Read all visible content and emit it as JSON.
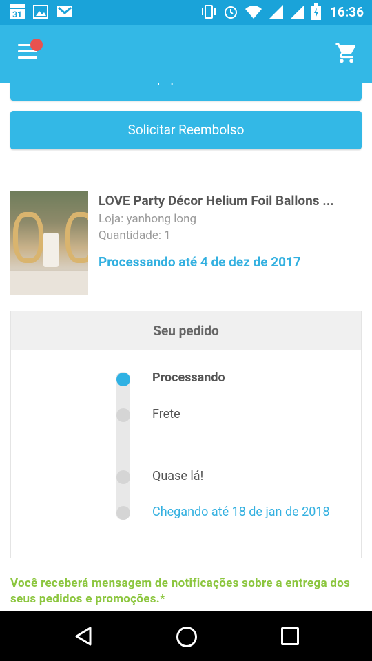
{
  "status_bar": {
    "calendar_day": "31",
    "time": "16:36",
    "icons": [
      "calendar-icon",
      "image-icon",
      "gmail-icon",
      "vibrate-icon",
      "alarm-icon",
      "wifi-icon",
      "signal-icon",
      "signal-icon",
      "battery-icon"
    ]
  },
  "app_bar": {
    "menu_icon": "hamburger-menu-icon",
    "cart_icon": "shopping-cart-icon",
    "notification_dot_color": "#e8524f"
  },
  "buttons": {
    "contact": "Contatar Equipe de Atendimento",
    "refund": "Solicitar Reembolso"
  },
  "product": {
    "title": "LOVE Party Décor Helium Foil Ballons ...",
    "store": "Loja: yanhong long",
    "quantity": "Quantidade: 1",
    "status": "Processando até 4 de dez de 2017"
  },
  "order": {
    "heading": "Seu pedido",
    "steps": [
      {
        "label": "Processando",
        "active": true
      },
      {
        "label": "Frete",
        "active": false
      },
      {
        "label": "Quase lá!",
        "active": false
      },
      {
        "label": "Chegando até 18 de jan de 2018",
        "active": false
      }
    ]
  },
  "notice": "Você receberá mensagem de notificações sobre a entrega dos seus pedidos e promoções.*",
  "colors": {
    "accent": "#33b8e6",
    "status_bar": "#1aa3d9",
    "highlight_text": "#33b0e0",
    "notice_green": "#8cc63f"
  },
  "nav_bar": {
    "icons": [
      "back-icon",
      "home-icon",
      "recent-apps-icon"
    ]
  }
}
